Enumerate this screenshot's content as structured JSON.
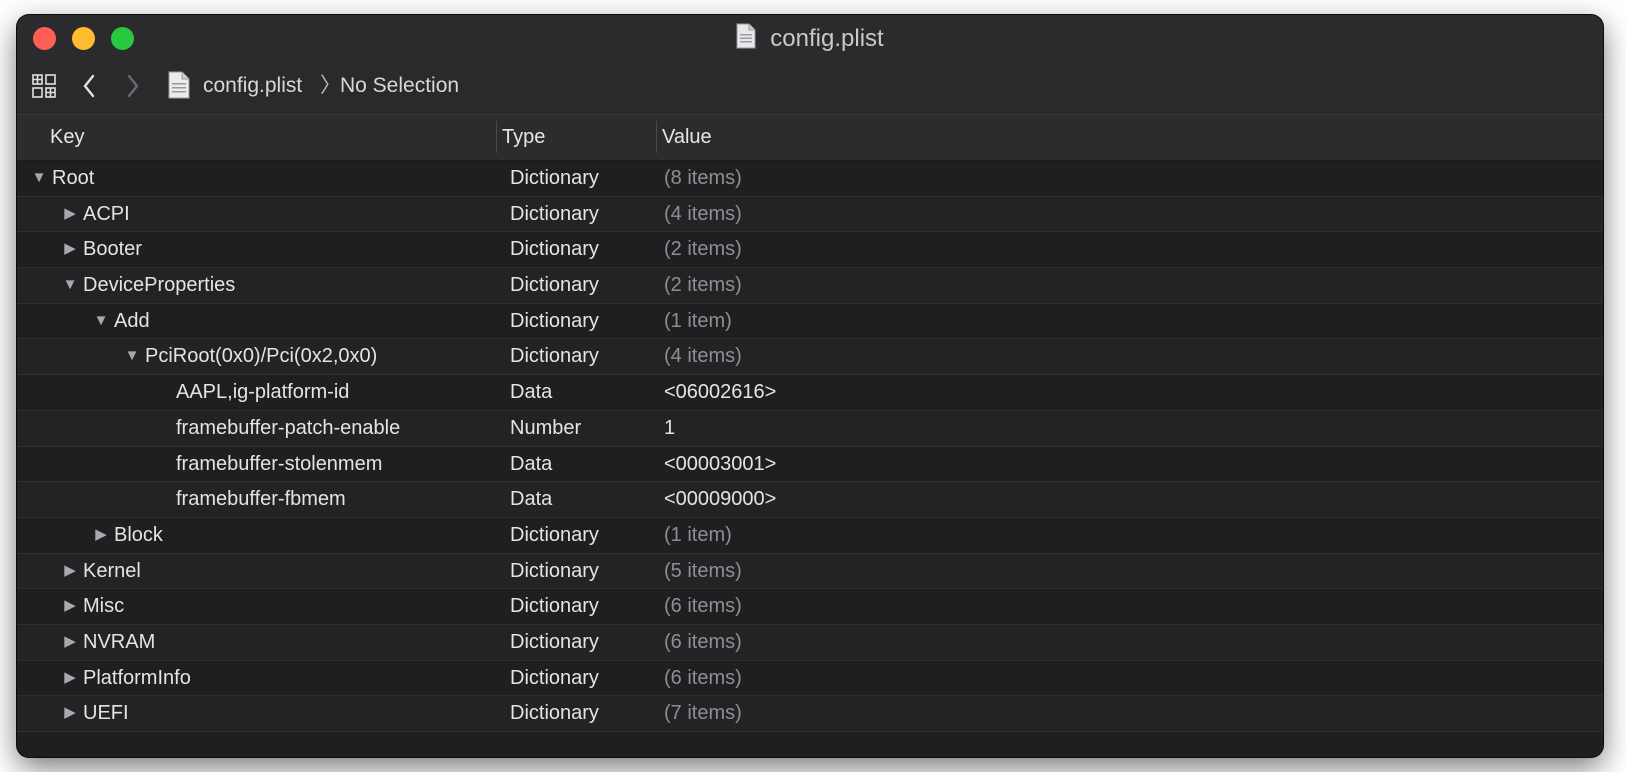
{
  "window": {
    "title": "config.plist"
  },
  "pathbar": {
    "file": "config.plist",
    "separator": "〉",
    "selection": "No Selection"
  },
  "columns": {
    "key": "Key",
    "type": "Type",
    "value": "Value"
  },
  "rows": [
    {
      "key": "Root",
      "type": "Dictionary",
      "value": "(8 items)",
      "level": 0,
      "disclosure": "expanded",
      "muted": true
    },
    {
      "key": "ACPI",
      "type": "Dictionary",
      "value": "(4 items)",
      "level": 1,
      "disclosure": "collapsed",
      "muted": true
    },
    {
      "key": "Booter",
      "type": "Dictionary",
      "value": "(2 items)",
      "level": 1,
      "disclosure": "collapsed",
      "muted": true
    },
    {
      "key": "DeviceProperties",
      "type": "Dictionary",
      "value": "(2 items)",
      "level": 1,
      "disclosure": "expanded",
      "muted": true
    },
    {
      "key": "Add",
      "type": "Dictionary",
      "value": "(1 item)",
      "level": 2,
      "disclosure": "expanded",
      "muted": true
    },
    {
      "key": "PciRoot(0x0)/Pci(0x2,0x0)",
      "type": "Dictionary",
      "value": "(4 items)",
      "level": 3,
      "disclosure": "expanded",
      "muted": true
    },
    {
      "key": "AAPL,ig-platform-id",
      "type": "Data",
      "value": "<06002616>",
      "level": 4,
      "disclosure": "none",
      "muted": false
    },
    {
      "key": "framebuffer-patch-enable",
      "type": "Number",
      "value": "1",
      "level": 4,
      "disclosure": "none",
      "muted": false
    },
    {
      "key": "framebuffer-stolenmem",
      "type": "Data",
      "value": "<00003001>",
      "level": 4,
      "disclosure": "none",
      "muted": false
    },
    {
      "key": "framebuffer-fbmem",
      "type": "Data",
      "value": "<00009000>",
      "level": 4,
      "disclosure": "none",
      "muted": false
    },
    {
      "key": "Block",
      "type": "Dictionary",
      "value": "(1 item)",
      "level": 2,
      "disclosure": "collapsed",
      "muted": true
    },
    {
      "key": "Kernel",
      "type": "Dictionary",
      "value": "(5 items)",
      "level": 1,
      "disclosure": "collapsed",
      "muted": true
    },
    {
      "key": "Misc",
      "type": "Dictionary",
      "value": "(6 items)",
      "level": 1,
      "disclosure": "collapsed",
      "muted": true
    },
    {
      "key": "NVRAM",
      "type": "Dictionary",
      "value": "(6 items)",
      "level": 1,
      "disclosure": "collapsed",
      "muted": true
    },
    {
      "key": "PlatformInfo",
      "type": "Dictionary",
      "value": "(6 items)",
      "level": 1,
      "disclosure": "collapsed",
      "muted": true
    },
    {
      "key": "UEFI",
      "type": "Dictionary",
      "value": "(7 items)",
      "level": 1,
      "disclosure": "collapsed",
      "muted": true
    }
  ],
  "icons": {
    "grid": "related-items-grid-icon",
    "back": "chevron-left-icon",
    "forward": "chevron-right-icon",
    "file": "plist-file-icon"
  },
  "colors": {
    "window_bg": "#1f1f21",
    "close": "#fd5f57",
    "minimize": "#febc2e",
    "maximize": "#28c840",
    "muted_value": "#8f8f93"
  }
}
